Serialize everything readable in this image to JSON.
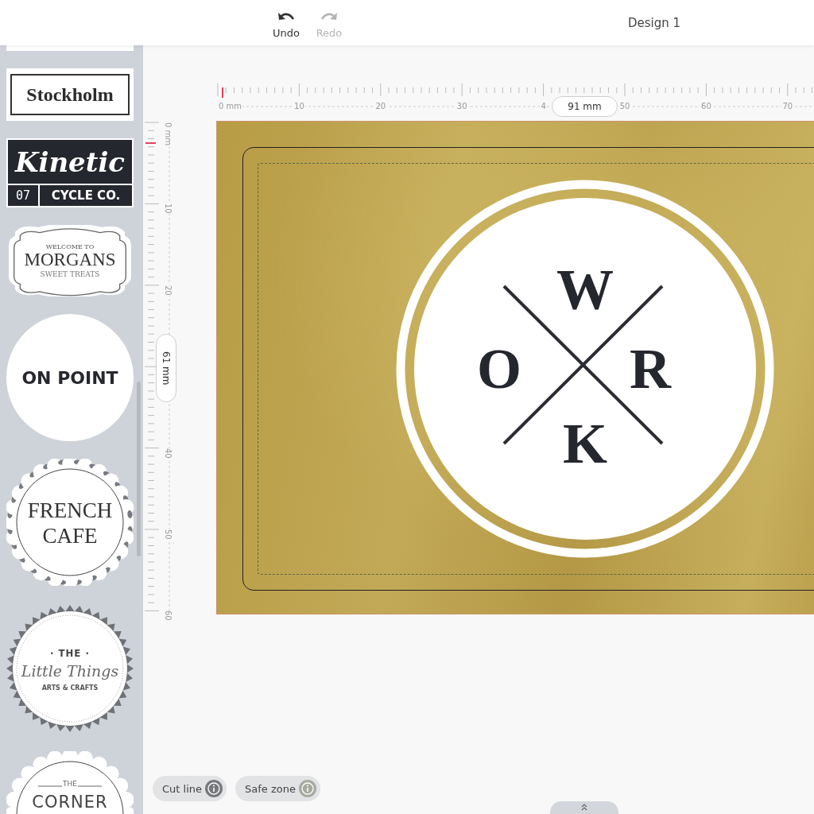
{
  "toolbar": {
    "actions": [
      {
        "label": "Undo",
        "disabled": false
      },
      {
        "label": "Redo",
        "disabled": true
      }
    ],
    "design_name": "Design 1"
  },
  "templates": [
    {
      "kind": "partial"
    },
    {
      "kind": "frame",
      "texts": [
        "Stockholm"
      ]
    },
    {
      "kind": "kinetic",
      "texts": [
        "Kinetic",
        "07",
        "CYCLE CO."
      ]
    },
    {
      "kind": "label",
      "texts": [
        "WELCOME TO",
        "MORGANS",
        "SWEET TREATS"
      ]
    },
    {
      "kind": "circle",
      "texts": [
        "ON POINT"
      ]
    },
    {
      "kind": "scallop",
      "texts": [
        "FRENCH",
        "CAFE"
      ]
    },
    {
      "kind": "badge",
      "texts": [
        "· THE ·",
        "Little Things",
        "ARTS & CRAFTS"
      ]
    },
    {
      "kind": "scallop-top",
      "texts": [
        "THE",
        "CORNER"
      ]
    }
  ],
  "ruler_x": {
    "labels": [
      "0 mm",
      "10",
      "20",
      "30",
      "4",
      "50",
      "60",
      "70"
    ],
    "size": "91 mm"
  },
  "ruler_y": {
    "labels": [
      "0 mm",
      "10",
      "20",
      "40",
      "50",
      "60"
    ],
    "size": "61 mm"
  },
  "design": {
    "letters": [
      "W",
      "O",
      "R",
      "K"
    ]
  },
  "toggles": [
    {
      "label": "Cut line",
      "on": true
    },
    {
      "label": "Safe zone",
      "on": false
    }
  ]
}
